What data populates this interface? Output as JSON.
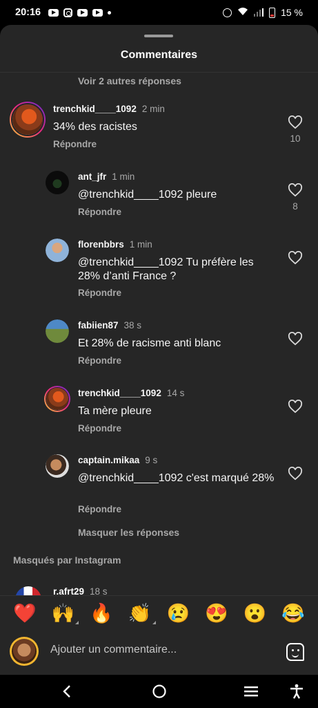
{
  "status_bar": {
    "time": "20:16",
    "battery": "15 %",
    "notification_icons": [
      "youtube-icon",
      "instagram-icon",
      "youtube-icon",
      "youtube-icon",
      "dot-icon"
    ],
    "system_icons": [
      "alarm-icon",
      "wifi-icon",
      "signal-icon",
      "battery-low-icon"
    ]
  },
  "sheet": {
    "title": "Commentaires",
    "view_more_replies": "Voir 2 autres réponses"
  },
  "comments": [
    {
      "username": "trenchkid____1092",
      "time": "2 min",
      "text": "34% des racistes",
      "reply": "Répondre",
      "likes": "10"
    },
    {
      "username": "ant_jfr",
      "time": "1 min",
      "text": "@trenchkid____1092 pleure",
      "reply": "Répondre",
      "likes": "8"
    },
    {
      "username": "florenbbrs",
      "time": "1 min",
      "text": "@trenchkid____1092 Tu préfère les 28% d’anti France ?",
      "reply": "Répondre",
      "likes": ""
    },
    {
      "username": "fabiien87",
      "time": "38 s",
      "text": "Et 28% de racisme anti blanc",
      "reply": "Répondre",
      "likes": ""
    },
    {
      "username": "trenchkid____1092",
      "time": "14 s",
      "text": "Ta mère pleure",
      "reply": "Répondre",
      "likes": ""
    },
    {
      "username": "captain.mikaa",
      "time": "9 s",
      "text": "@trenchkid____1092 c'est marqué 28%",
      "reply": "Répondre",
      "likes": ""
    }
  ],
  "hide_replies": "Masquer les réponses",
  "hidden_section": "Masqués par Instagram",
  "partial_comment": {
    "username": "r.afrt29",
    "time": "18 s"
  },
  "emoji_bar": [
    "❤️",
    "🙌",
    "🔥",
    "👏",
    "😢",
    "😍",
    "😮",
    "😂"
  ],
  "composer": {
    "placeholder": "Ajouter un commentaire..."
  },
  "colors": {
    "background": "#262626",
    "text": "#f5f5f5",
    "secondary": "#a8a8a8",
    "story_ring": "#ee2a7b"
  }
}
